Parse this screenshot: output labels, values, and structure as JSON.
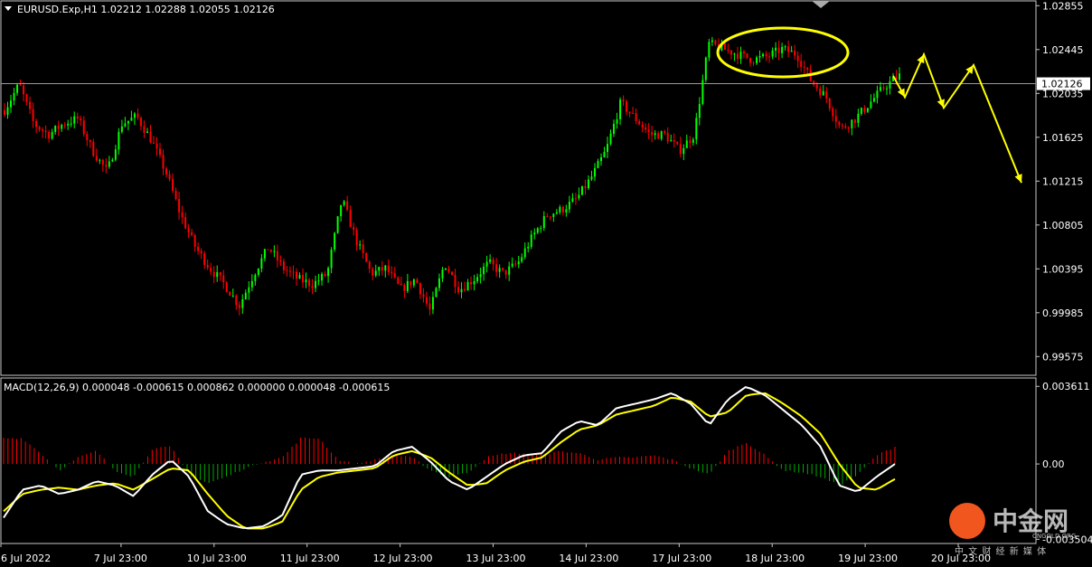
{
  "main_header": "EURUSD.Exp,H1  1.02212 1.02288 1.02055 1.02126",
  "macd_header": "MACD(12,26,9) 0.000048 -0.000615 0.000862 0.000000 0.000048 -0.000615",
  "watermark": {
    "brand": "中金网",
    "domain": "CNGOLD.ORG",
    "tagline": "中 文 财 经 新 媒 体"
  },
  "chart_data": [
    {
      "type": "candlestick",
      "symbol": "EURUSD.Exp",
      "timeframe": "H1",
      "ylim": [
        0.994,
        1.029
      ],
      "price_ticks": [
        "1.02855",
        "1.02445",
        "1.02035",
        "1.01625",
        "1.01215",
        "1.00805",
        "1.00395",
        "0.99985",
        "0.99575"
      ],
      "current_price": 1.02126,
      "current_price_label": "1.02126",
      "time_ticks": [
        "6 Jul 2022",
        "7 Jul 23:00",
        "10 Jul 23:00",
        "11 Jul 23:00",
        "12 Jul 23:00",
        "13 Jul 23:00",
        "14 Jul 23:00",
        "17 Jul 23:00",
        "18 Jul 23:00",
        "19 Jul 23:00",
        "20 Jul 23:00"
      ],
      "bull_color": "#00ff00",
      "bear_color": "#ff0000",
      "path_close": [
        1.0188,
        1.0212,
        1.0175,
        1.0165,
        1.0175,
        1.018,
        1.015,
        1.013,
        1.0175,
        1.0182,
        1.016,
        1.013,
        1.009,
        1.006,
        1.004,
        1.0025,
        1.0005,
        1.0035,
        1.006,
        1.004,
        1.003,
        1.0025,
        1.0035,
        1.0105,
        1.0065,
        1.0035,
        1.004,
        1.002,
        1.003,
        1.0,
        1.0045,
        1.002,
        1.003,
        1.0045,
        1.0035,
        1.0045,
        1.007,
        1.009,
        1.0095,
        1.0105,
        1.0125,
        1.015,
        1.0195,
        1.018,
        1.0165,
        1.0165,
        1.015,
        1.0165,
        1.025,
        1.0245,
        1.024,
        1.0235,
        1.0238,
        1.0245,
        1.024,
        1.0215,
        1.02,
        1.017,
        1.018,
        1.0195,
        1.021,
        1.022
      ],
      "annotation": {
        "type": "ellipse",
        "color": "#ffff00",
        "around": "18-19 Jul consolidation near 1.0240"
      },
      "forecast_path": [
        1.022,
        1.02,
        1.024,
        1.019,
        1.023,
        1.012
      ],
      "forecast_color": "#ffff00"
    },
    {
      "type": "macd",
      "params": [
        12,
        26,
        9
      ],
      "ylim": [
        -0.0037,
        0.004
      ],
      "ticks": [
        "0.003611",
        "0.00",
        "-0.003504"
      ],
      "macd_color": "#ffffff",
      "signal_color": "#ffff00",
      "hist_pos_color": "#ff0000",
      "hist_neg_color": "#00aa00",
      "macd_path": [
        -0.0025,
        -0.0012,
        -0.001,
        -0.0014,
        -0.0012,
        -0.0008,
        -0.001,
        -0.0015,
        -0.0005,
        0.0002,
        -0.0006,
        -0.0022,
        -0.0028,
        -0.003,
        -0.0029,
        -0.0024,
        -0.0005,
        -0.0003,
        -0.0003,
        -0.0002,
        -0.0001,
        0.0006,
        0.0008,
        0.0001,
        -0.0008,
        -0.0012,
        -0.0006,
        0.0,
        0.0004,
        0.0005,
        0.0015,
        0.002,
        0.0018,
        0.0026,
        0.0028,
        0.003,
        0.0033,
        0.0028,
        0.0018,
        0.003,
        0.0036,
        0.0032,
        0.0025,
        0.0018,
        0.0008,
        -0.001,
        -0.0013,
        -0.0006,
        0.0
      ],
      "signal_path": [
        -0.0022,
        -0.0014,
        -0.0012,
        -0.0011,
        -0.0012,
        -0.001,
        -0.0009,
        -0.0012,
        -0.0007,
        -0.0002,
        -0.0003,
        -0.0014,
        -0.0024,
        -0.003,
        -0.003,
        -0.0027,
        -0.0012,
        -0.0006,
        -0.0004,
        -0.0003,
        -0.0002,
        0.0004,
        0.0006,
        0.0003,
        -0.0004,
        -0.001,
        -0.0009,
        -0.0003,
        0.0001,
        0.0003,
        0.001,
        0.0016,
        0.0018,
        0.0023,
        0.0025,
        0.0027,
        0.0031,
        0.0029,
        0.0022,
        0.0024,
        0.0032,
        0.0033,
        0.0028,
        0.0022,
        0.0014,
        0.0,
        -0.0011,
        -0.0012,
        -0.0007
      ],
      "hist_path": [
        0.0012,
        0.0012,
        0.0005,
        -0.0003,
        0.0003,
        0.0006,
        -0.0003,
        -0.0006,
        0.0007,
        0.0008,
        -0.0005,
        -0.0009,
        -0.0006,
        -0.0002,
        0.0001,
        0.0003,
        0.0012,
        0.0012,
        0.0002,
        0.0,
        0.0002,
        0.0004,
        0.0003,
        -0.0003,
        -0.0006,
        -0.0004,
        0.0003,
        0.0005,
        0.0005,
        0.0004,
        0.0006,
        0.0005,
        0.0002,
        0.0003,
        0.0003,
        0.0004,
        0.0002,
        -0.0002,
        -0.0005,
        0.0006,
        0.001,
        0.0004,
        -0.0003,
        -0.0004,
        -0.0006,
        -0.001,
        -0.0005,
        0.0004,
        0.0008
      ]
    }
  ]
}
